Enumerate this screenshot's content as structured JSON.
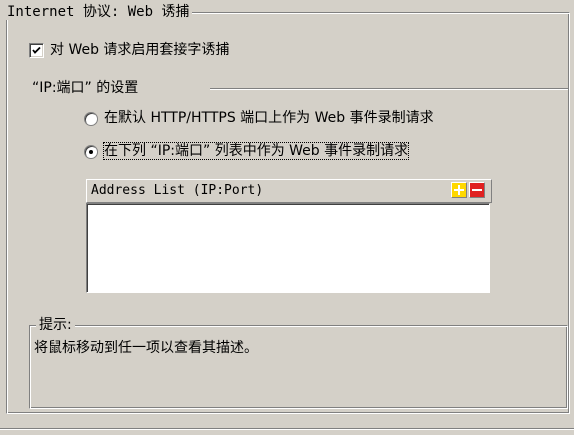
{
  "groups": {
    "protocol_title": "Internet 协议: Web 诱捕",
    "ipport_title": "“IP:端口” 的设置",
    "hint_title": "提示:"
  },
  "options": {
    "enable_socket_label": "对 Web 请求启用套接字诱捕",
    "enable_socket_checked": true,
    "radio_default_label": "在默认 HTTP/HTTPS 端口上作为 Web 事件录制请求",
    "radio_list_label": "在下列 “IP:端口” 列表中作为 Web 事件录制请求",
    "selected_radio": "list"
  },
  "address_list": {
    "header": "Address List (IP:Port)",
    "add_icon": "plus-icon",
    "remove_icon": "minus-icon",
    "items": []
  },
  "hint": {
    "text": "将鼠标移动到任一项以查看其描述。"
  },
  "colors": {
    "face": "#d4d0c8",
    "shadow": "#808080",
    "highlight": "#ffffff",
    "add_icon": "#ffd800",
    "remove_icon": "#e02020"
  }
}
